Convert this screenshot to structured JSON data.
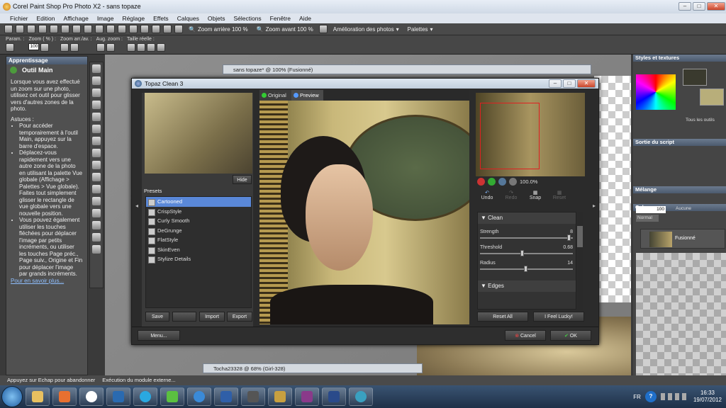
{
  "app": {
    "title": "Corel Paint Shop Pro Photo X2 - sans topaze"
  },
  "menu": [
    "Fichier",
    "Edition",
    "Affichage",
    "Image",
    "Réglage",
    "Effets",
    "Calques",
    "Objets",
    "Sélections",
    "Fenêtre",
    "Aide"
  ],
  "toolbar": {
    "zoom_out": "Zoom arrière 100 %",
    "zoom_in": "Zoom avant 100 %",
    "enhance": "Amélioration des photos",
    "palettes": "Palettes"
  },
  "tool_options": {
    "params": "Param. :",
    "zoom_label": "Zoom ( % ) :",
    "zoom_value": "100",
    "zoom_prev": "Zoom arr./av. :",
    "zoom_aug": "Aug. zoom :",
    "real_size": "Taille réelle :"
  },
  "learning": {
    "title": "Apprentissage",
    "tool_name": "Outil Main",
    "intro": "Lorsque vous avez effectué un zoom sur une photo, utilisez cet outil pour glisser vers d'autres zones de la photo.",
    "tips_title": "Astuces :",
    "tips": [
      "Pour accéder temporairement à l'outil Main, appuyez sur la barre d'espace.",
      "Déplacez-vous rapidement vers une autre zone de la photo en utilisant la palette Vue globale (Affichage > Palettes > Vue globale). Faites tout simplement glisser le rectangle de vue globale vers une nouvelle position.",
      "Vous pouvez également utiliser les touches fléchées pour déplacer l'image par petits incréments, ou utiliser les touches Page préc., Page suiv., Origine et Fin pour déplacer l'image par grands incréments."
    ],
    "more": "Pour en savoir plus..."
  },
  "docs": {
    "doc1": "sans topaze* @ 100% (Fusionné)",
    "doc2": "Tocha23328 @ 68% (Girl-328)"
  },
  "right": {
    "styles": "Styles et textures",
    "all_tools": "Tous les outils",
    "script": "Sortie du script",
    "mix": "Mélange",
    "layers": "Calques",
    "opacity": "100",
    "blend": "Normal",
    "none": "Aucune",
    "layer_name": "Fusionné"
  },
  "topaz": {
    "title": "Topaz Clean 3",
    "tab_original": "Original",
    "tab_preview": "Preview",
    "hide": "Hide",
    "presets_label": "Presets",
    "presets": [
      "Cartooned",
      "CrispStyle",
      "Curly Smooth",
      "DeGrunge",
      "FlatStyle",
      "SkinEven",
      "Stylize Details"
    ],
    "btn_save": "Save",
    "btn_import": "Import",
    "btn_export": "Export",
    "menu": "Menu...",
    "zoom": "100.0%",
    "undo": "Undo",
    "redo": "Redo",
    "snap": "Snap",
    "reset": "Reset",
    "section_clean": "Clean",
    "strength_label": "Strength",
    "strength_value": "8",
    "threshold_label": "Threshold",
    "threshold_value": "0.68",
    "radius_label": "Radius",
    "radius_value": "14",
    "section_edges": "Edges",
    "reset_all": "Reset All",
    "feel_lucky": "I Feel Lucky!",
    "cancel": "Cancel",
    "ok": "OK"
  },
  "status": {
    "left": "Appuyez sur Echap pour abandonner",
    "right": "Exécution du module externe..."
  },
  "tray": {
    "lang": "FR",
    "time": "16:33",
    "date": "19/07/2012"
  },
  "slider_levels": {
    "strength": 0.98,
    "threshold": 0.45,
    "radius": 0.49
  },
  "colors": {
    "accent": "#5a88d8",
    "tray_help": "#1f6fc9"
  }
}
